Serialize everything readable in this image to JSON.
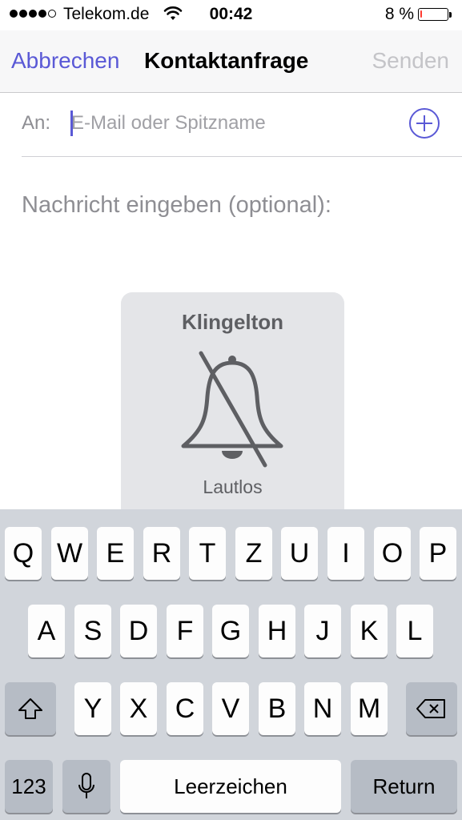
{
  "status_bar": {
    "carrier": "Telekom.de",
    "time": "00:42",
    "battery_text": "8 %",
    "battery_level": 0.08,
    "signal_bars_filled": 4,
    "signal_bars_total": 5,
    "icons": [
      "wifi-icon",
      "battery-icon"
    ]
  },
  "nav": {
    "cancel": "Abbrechen",
    "title": "Kontaktanfrage",
    "send": "Senden"
  },
  "to_field": {
    "label": "An:",
    "placeholder": "E-Mail oder Spitzname",
    "add_icon": "plus-circle-icon"
  },
  "message": {
    "placeholder": "Nachricht eingeben (optional):"
  },
  "hud": {
    "title": "Klingelton",
    "status": "Lautlos",
    "icon": "bell-muted-icon"
  },
  "keyboard": {
    "row1": [
      "Q",
      "W",
      "E",
      "R",
      "T",
      "Z",
      "U",
      "I",
      "O",
      "P"
    ],
    "row2": [
      "A",
      "S",
      "D",
      "F",
      "G",
      "H",
      "J",
      "K",
      "L"
    ],
    "row3": [
      "Y",
      "X",
      "C",
      "V",
      "B",
      "N",
      "M"
    ],
    "shift_icon": "shift-icon",
    "delete_icon": "backspace-icon",
    "numbers": "123",
    "mic_icon": "microphone-icon",
    "space": "Leerzeichen",
    "return": "Return"
  },
  "colors": {
    "accent": "#5a59d6",
    "disabled": "#c4c4c8",
    "placeholder": "#8e8e93",
    "keyboard_bg": "#d1d5db"
  }
}
